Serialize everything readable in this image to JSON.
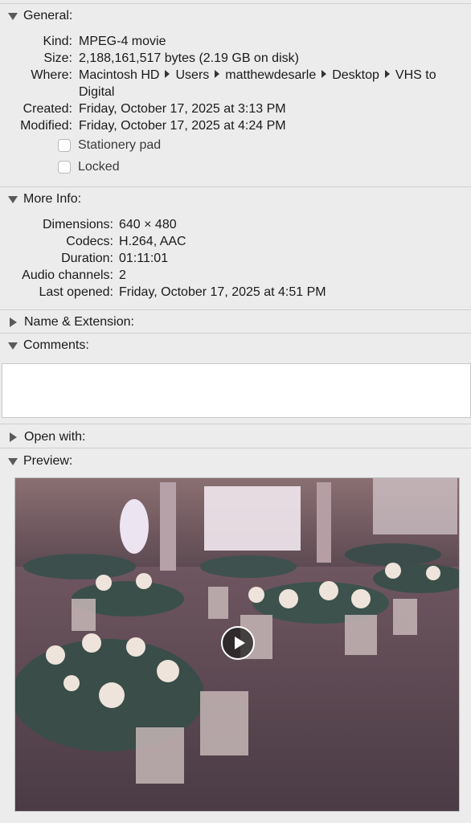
{
  "general": {
    "title": "General:",
    "kind_label": "Kind:",
    "kind": "MPEG-4 movie",
    "size_label": "Size:",
    "size": "2,188,161,517 bytes (2.19 GB on disk)",
    "where_label": "Where:",
    "where_path": [
      "Macintosh HD",
      "Users",
      "matthewdesarle",
      "Desktop",
      "VHS to Digital"
    ],
    "created_label": "Created:",
    "created": "Friday, October 17, 2025 at 3:13 PM",
    "modified_label": "Modified:",
    "modified": "Friday, October 17, 2025 at 4:24 PM",
    "stationery_label": "Stationery pad",
    "stationery_checked": false,
    "locked_label": "Locked",
    "locked_checked": false
  },
  "more_info": {
    "title": "More Info:",
    "dimensions_label": "Dimensions:",
    "dimensions": "640 × 480",
    "codecs_label": "Codecs:",
    "codecs": "H.264, AAC",
    "duration_label": "Duration:",
    "duration": "01:11:01",
    "audio_channels_label": "Audio channels:",
    "audio_channels": "2",
    "last_opened_label": "Last opened:",
    "last_opened": "Friday, October 17, 2025 at 4:51 PM"
  },
  "name_extension": {
    "title": "Name & Extension:"
  },
  "comments": {
    "title": "Comments:",
    "value": ""
  },
  "open_with": {
    "title": "Open with:"
  },
  "preview": {
    "title": "Preview:",
    "play_icon": "play-icon"
  },
  "colors": {
    "background": "#ececec",
    "divider": "#cfcfcf",
    "triangle": "#5a5a5a"
  }
}
